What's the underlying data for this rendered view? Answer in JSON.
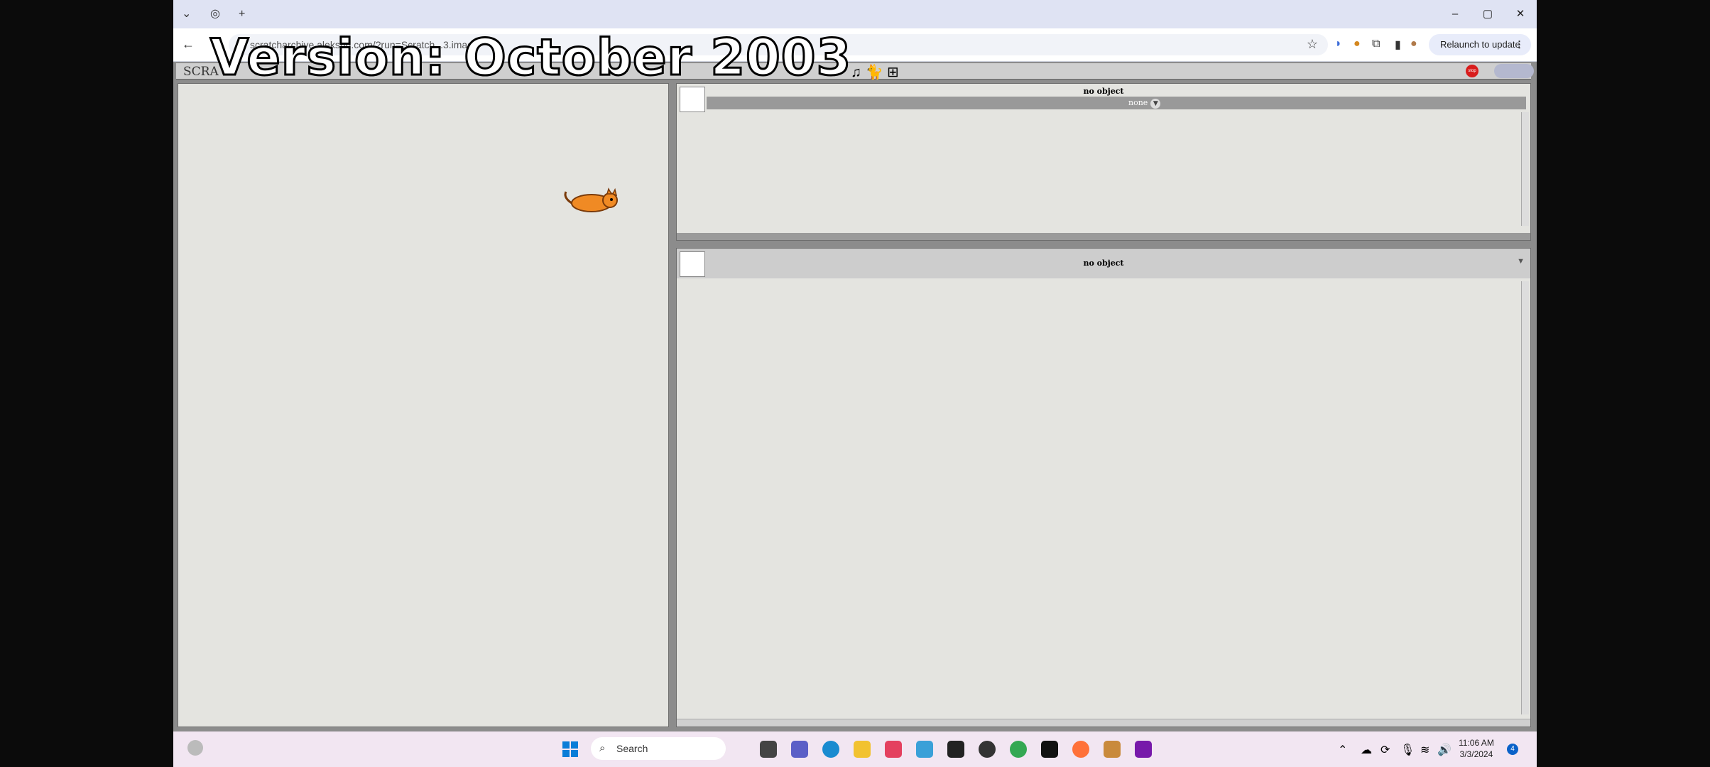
{
  "caption": "Version: October 2003",
  "browser": {
    "url": "scratcharchive.aleksuh.com/?run=Scratch...3.image",
    "relaunch_label": "Relaunch to update",
    "tab_new": "+",
    "ctrl_min": "–",
    "ctrl_max": "▢",
    "ctrl_close": "✕"
  },
  "scratch": {
    "logo": "SCRA",
    "top_pane": {
      "title": "no object",
      "dropdown_value": "none"
    },
    "bottom_pane": {
      "title": "no object"
    },
    "stop_label": "stop"
  },
  "taskbar": {
    "search_label": "Search",
    "time": "11:06 AM",
    "date": "3/3/2024",
    "notification_count": "4"
  },
  "colors": {
    "accent_blue": "#0a7dd8",
    "stop_red": "#d81c1c"
  }
}
